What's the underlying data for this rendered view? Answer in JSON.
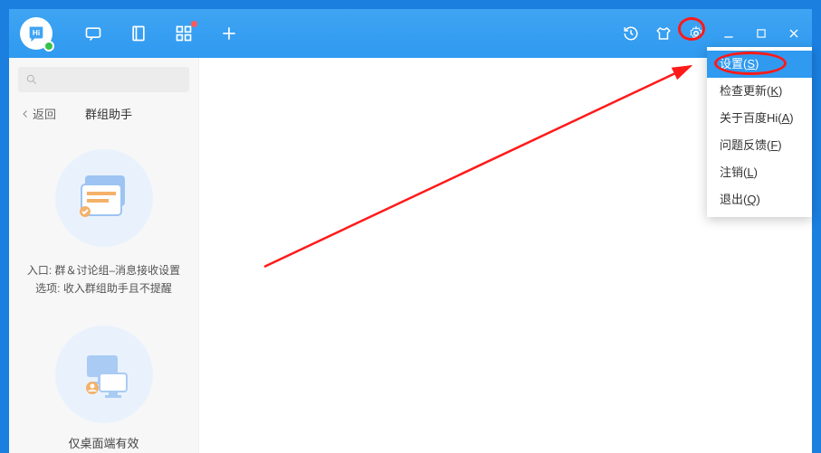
{
  "titlebar": {
    "history_tip": "历史",
    "skin_tip": "皮肤",
    "settings_tip": "设置",
    "min_tip": "最小化",
    "max_tip": "最大化",
    "close_tip": "关闭"
  },
  "search": {
    "placeholder": ""
  },
  "crumb": {
    "back": "返回",
    "title": "群组助手"
  },
  "feat1": {
    "line1": "入口: 群＆讨论组–消息接收设置",
    "line2": "选项: 收入群组助手且不提醒"
  },
  "feat2": {
    "text": "仅桌面端有效"
  },
  "menu": {
    "items": [
      {
        "label": "设置",
        "key": "S",
        "selected": true
      },
      {
        "label": "检查更新",
        "key": "K",
        "selected": false
      },
      {
        "label": "关于百度Hi",
        "key": "A",
        "selected": false
      },
      {
        "label": "问题反馈",
        "key": "F",
        "selected": false
      },
      {
        "label": "注销",
        "key": "L",
        "selected": false
      },
      {
        "label": "退出",
        "key": "Q",
        "selected": false
      }
    ]
  }
}
